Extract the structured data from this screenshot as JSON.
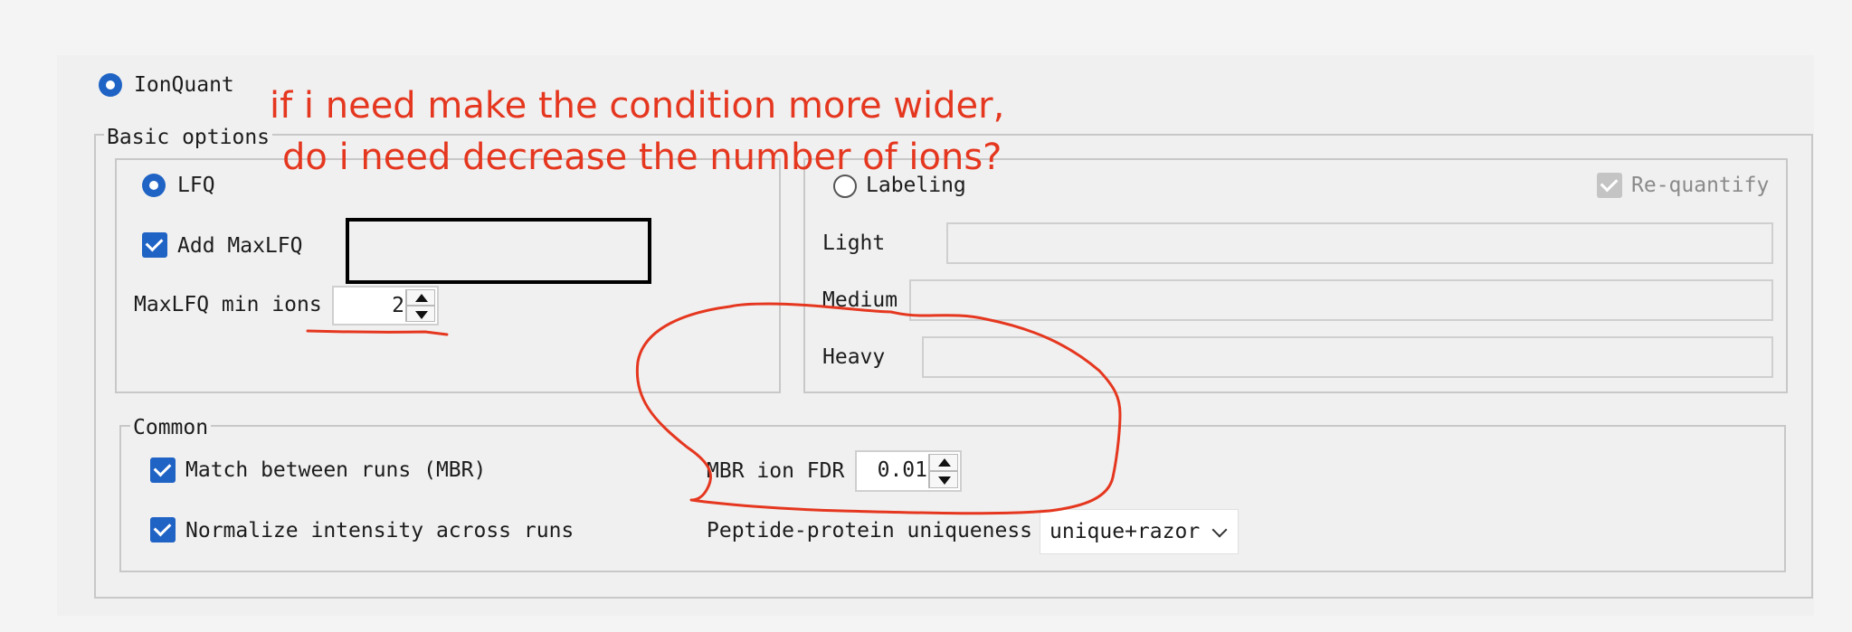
{
  "quant": {
    "ionquant_label": "IonQuant",
    "basic_options_legend": "Basic options",
    "lfq_label": "LFQ",
    "add_maxlfq_label": "Add MaxLFQ",
    "maxlfq_min_ions_label": "MaxLFQ min ions",
    "maxlfq_min_ions_value": "2",
    "labeling_label": "Labeling",
    "requantify_label": "Re-quantify",
    "light_label": "Light",
    "light_value": "",
    "medium_label": "Medium",
    "medium_value": "",
    "heavy_label": "Heavy",
    "heavy_value": "",
    "common_legend": "Common",
    "mbr_label": "Match between runs (MBR)",
    "normalize_label": "Normalize intensity across runs",
    "mbr_fdr_label": "MBR ion FDR",
    "mbr_fdr_value": "0.01",
    "uniqueness_label": "Peptide-protein uniqueness",
    "uniqueness_value": "unique+razor"
  },
  "annotation": {
    "line1": "if i need make the condition more wider,",
    "line2": "do i need decrease the number of ions?"
  },
  "colors": {
    "accent": "#1f63c5",
    "annotation": "#e5371f"
  }
}
